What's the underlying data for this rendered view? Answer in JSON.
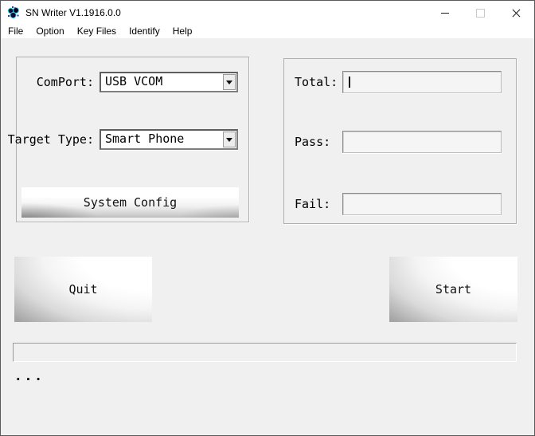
{
  "window": {
    "title": "SN Writer V1.1916.0.0",
    "titlebar_icons": [
      "app-icon",
      "minimize-icon",
      "maximize-icon",
      "close-icon"
    ]
  },
  "colors": {
    "titlebar_bg": "#ffffff",
    "client_bg": "#f0f0f0",
    "field_bg": "#f5f5f5",
    "window_border": "#5a5a5a",
    "icon_navy": "#0a0a33",
    "icon_cyan": "#35d0e5",
    "icon_blue": "#2233cc"
  },
  "menu": {
    "items": [
      {
        "label": "File"
      },
      {
        "label": "Option"
      },
      {
        "label": "Key Files"
      },
      {
        "label": "Identify"
      },
      {
        "label": "Help"
      }
    ]
  },
  "config_panel": {
    "comport": {
      "label": "ComPort:",
      "value": "USB VCOM"
    },
    "target_type": {
      "label": "Target Type:",
      "value": "Smart Phone"
    },
    "system_config_button": "System Config"
  },
  "counters_panel": {
    "total": {
      "label": "Total:",
      "value": ""
    },
    "pass": {
      "label": "Pass:",
      "value": ""
    },
    "fail": {
      "label": "Fail:",
      "value": ""
    }
  },
  "actions": {
    "quit_button": "Quit",
    "start_button": "Start"
  },
  "status_bar": {
    "progress_percent": 0,
    "message": "..."
  }
}
